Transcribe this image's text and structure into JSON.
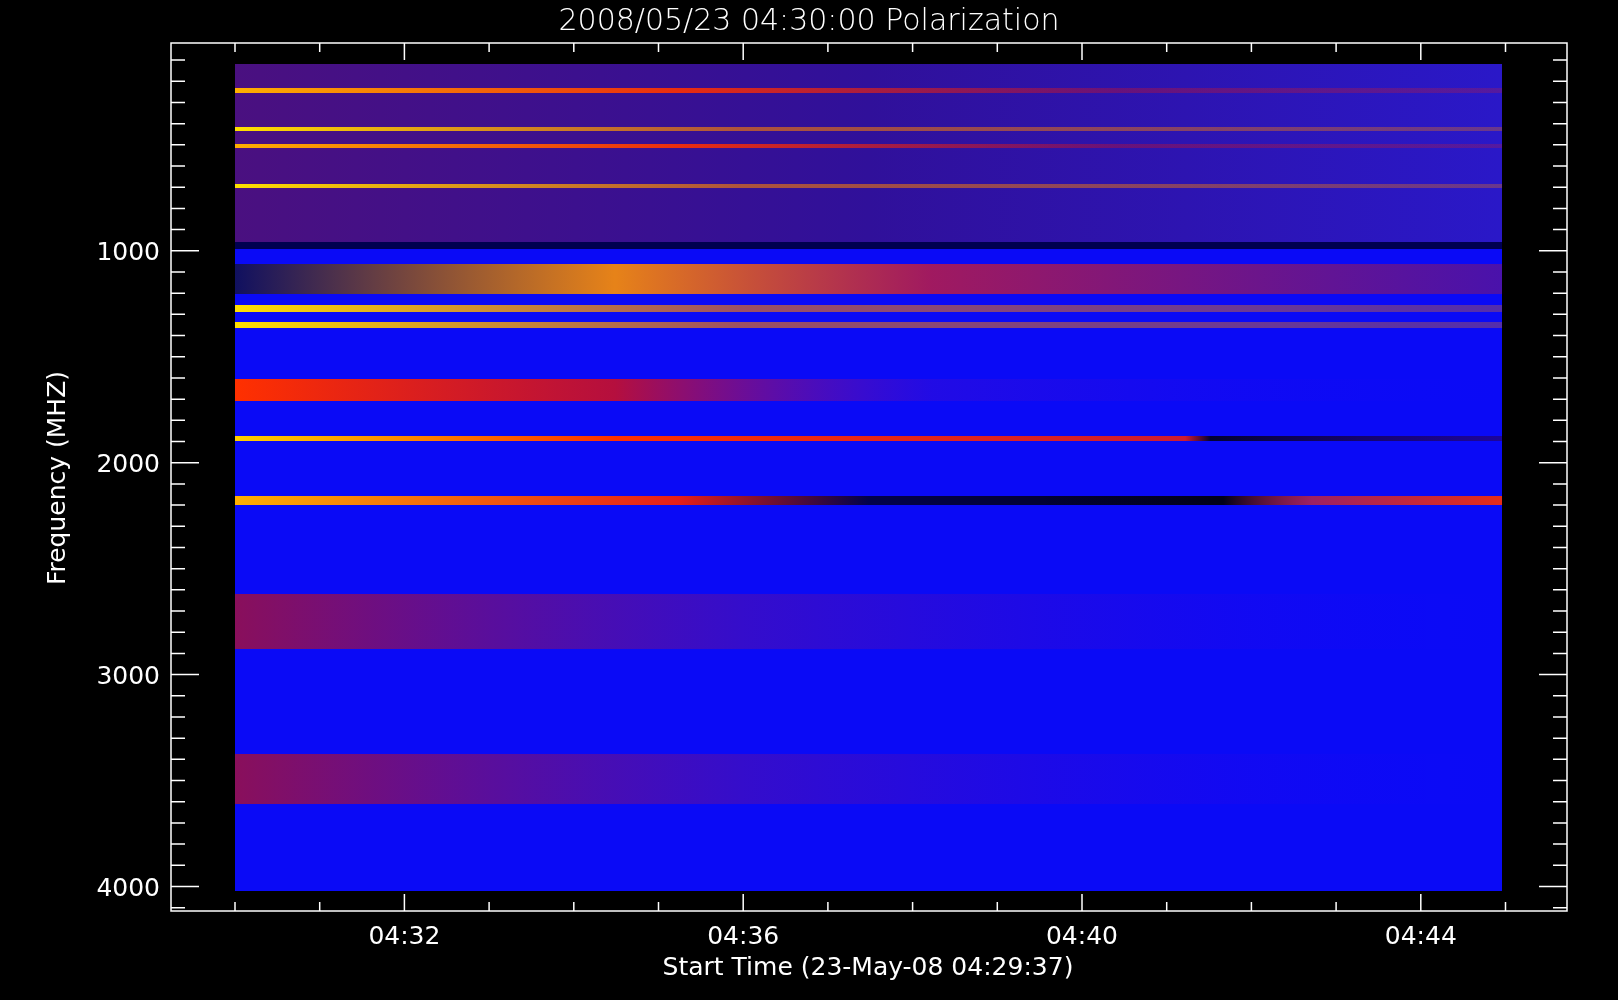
{
  "title": "2008/05/23 04:30:00 Polarization",
  "plot": {
    "ylabel": "Frequency (MHZ)",
    "yticks": [
      "1000",
      "2000",
      "3000",
      "4000"
    ],
    "xticks": [
      "04:32",
      "04:36",
      "04:40",
      "04:44"
    ],
    "xlabel": "Start Time (23-May-08 04:29:37)"
  }
}
